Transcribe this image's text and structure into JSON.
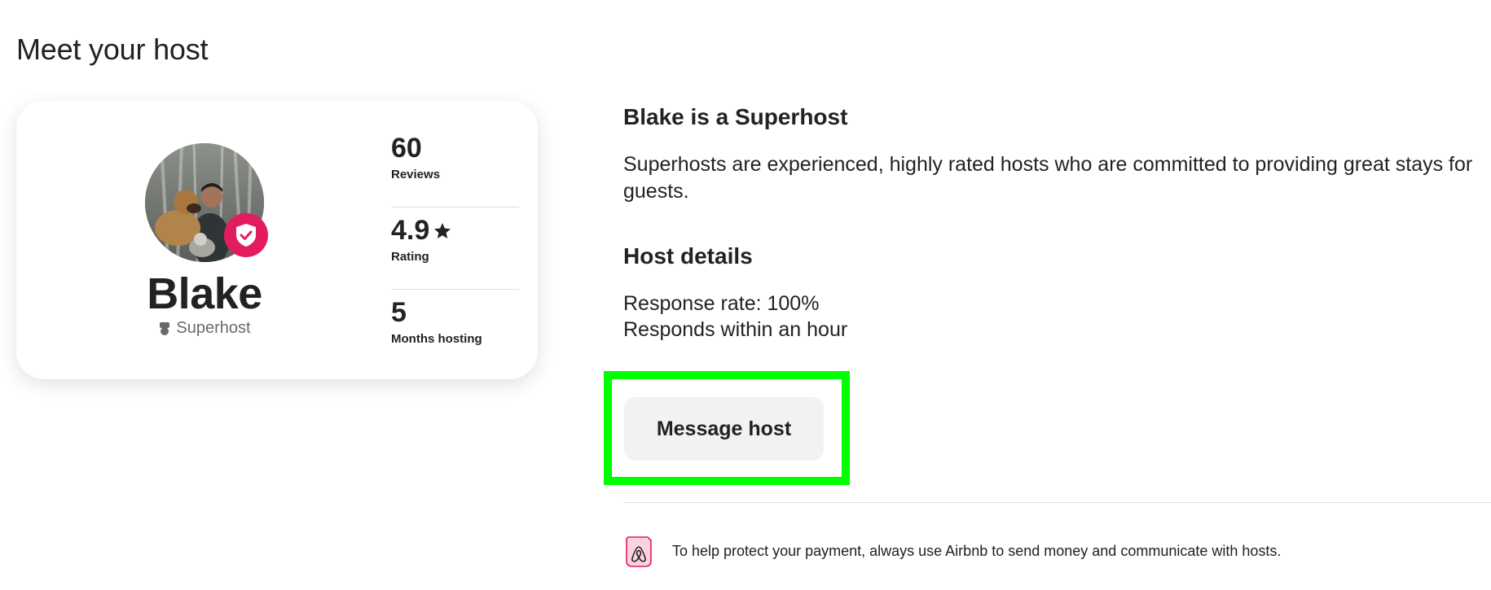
{
  "section": {
    "title": "Meet your host"
  },
  "host": {
    "name": "Blake",
    "role": "Superhost",
    "avatar_icon": "host-photo"
  },
  "stats": [
    {
      "value": "60",
      "label": "Reviews"
    },
    {
      "value": "4.9",
      "label": "Rating",
      "icon": "star-icon"
    },
    {
      "value": "5",
      "label": "Months hosting"
    }
  ],
  "superhost_info": {
    "heading": "Blake is a Superhost",
    "description": "Superhosts are experienced, highly rated hosts who are committed to providing great stays for guests."
  },
  "host_details": {
    "heading": "Host details",
    "response_rate": "Response rate: 100%",
    "response_time": "Responds within an hour"
  },
  "message_button": {
    "label": "Message host"
  },
  "notice": {
    "text": "To help protect your payment, always use Airbnb to send money and communicate with hosts.",
    "icon": "payment-shield-icon"
  },
  "colors": {
    "brand": "#e31c5f",
    "highlight": "#00ff00",
    "button_bg": "#f2f2f2",
    "text": "#222222",
    "muted": "#6a6a6a"
  }
}
